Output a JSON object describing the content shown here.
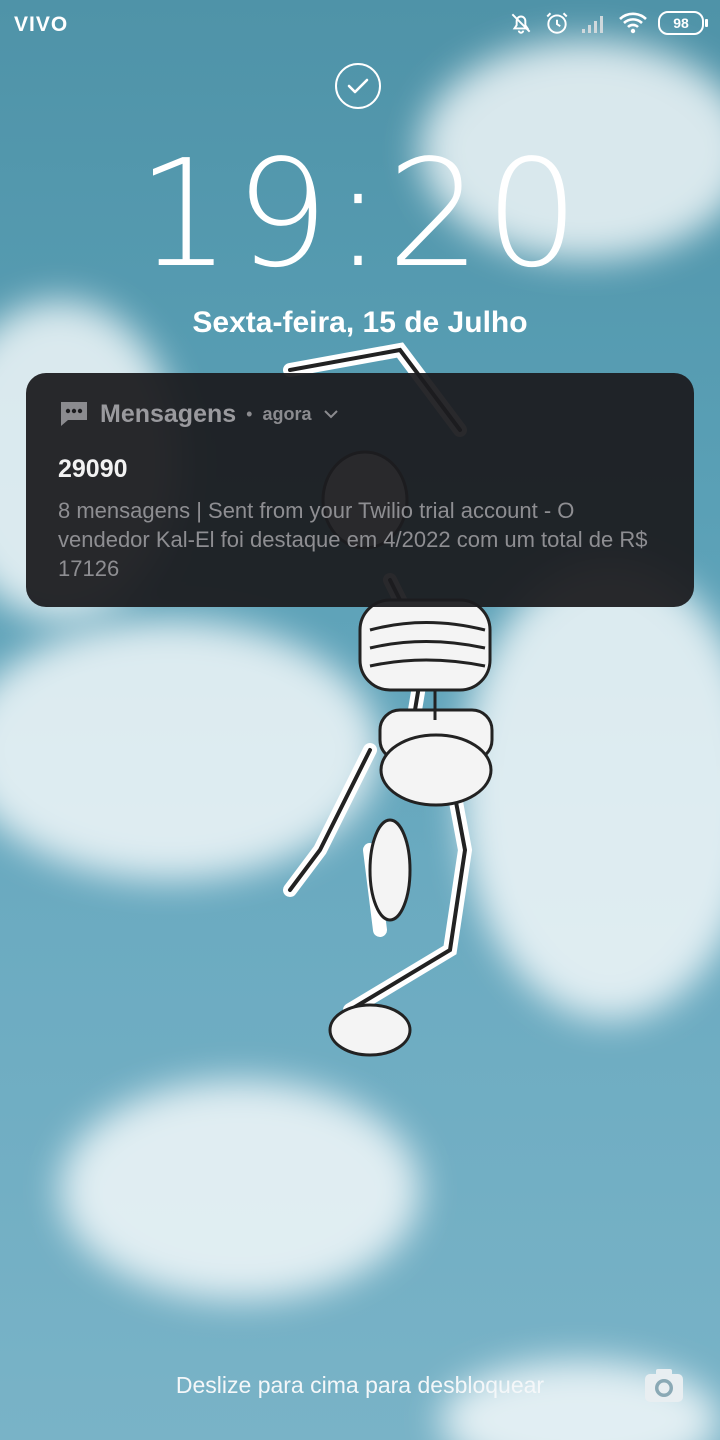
{
  "status_bar": {
    "carrier": "VIVO",
    "battery": "98"
  },
  "lock_screen": {
    "time": "19:20",
    "date": "Sexta-feira, 15 de Julho",
    "unlock_hint": "Deslize para cima para desbloquear"
  },
  "notification": {
    "app_name": "Mensagens",
    "time": "agora",
    "sender": "29090",
    "body": "8 mensagens | Sent from your Twilio trial account - O vendedor Kal-El foi destaque em 4/2022 com um total de R$ 17126"
  },
  "icons": [
    "bell-muted-icon",
    "alarm-icon",
    "signal-icon",
    "wifi-icon",
    "battery-icon",
    "check-circle-icon",
    "chat-bubble-icon",
    "chevron-down-icon",
    "camera-icon"
  ]
}
